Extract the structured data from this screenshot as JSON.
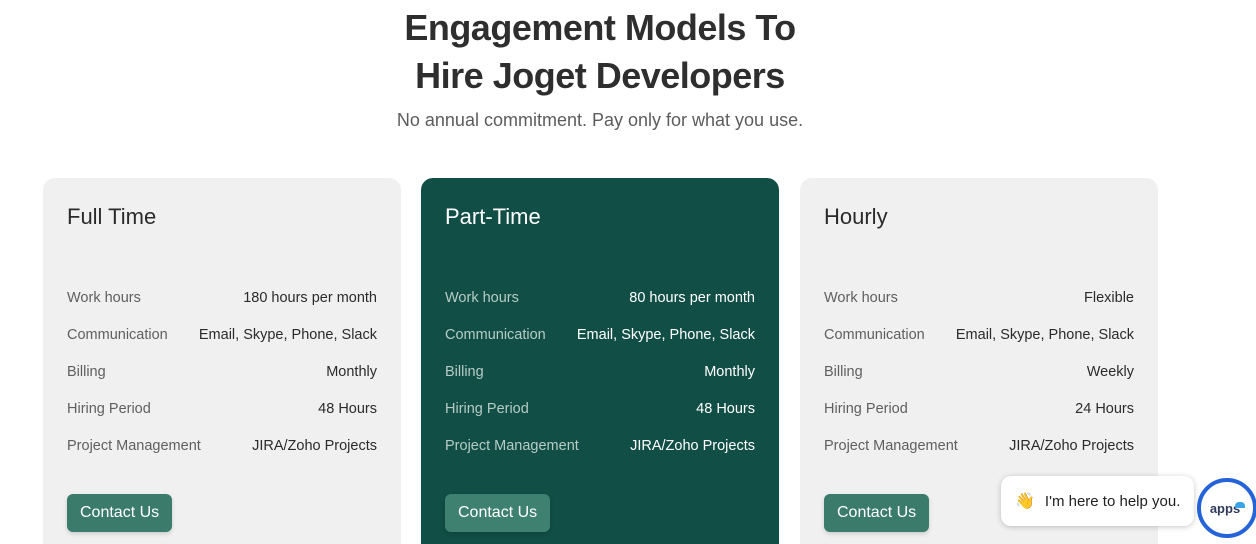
{
  "header": {
    "title_line1": "Engagement Models To",
    "title_line2": "Hire Joget Developers",
    "subtitle": "No annual commitment. Pay only for what you use."
  },
  "plans": [
    {
      "title": "Full Time",
      "rows": [
        {
          "label": "Work hours",
          "value": "180 hours per month"
        },
        {
          "label": "Communication",
          "value": "Email, Skype, Phone, Slack"
        },
        {
          "label": "Billing",
          "value": "Monthly"
        },
        {
          "label": "Hiring Period",
          "value": "48 Hours"
        },
        {
          "label": "Project Management",
          "value": "JIRA/Zoho Projects"
        }
      ],
      "button": "Contact Us"
    },
    {
      "title": "Part-Time",
      "rows": [
        {
          "label": "Work hours",
          "value": "80 hours per month"
        },
        {
          "label": "Communication",
          "value": "Email, Skype, Phone, Slack"
        },
        {
          "label": "Billing",
          "value": "Monthly"
        },
        {
          "label": "Hiring Period",
          "value": "48 Hours"
        },
        {
          "label": "Project Management",
          "value": "JIRA/Zoho Projects"
        }
      ],
      "button": "Contact Us"
    },
    {
      "title": "Hourly",
      "rows": [
        {
          "label": "Work hours",
          "value": "Flexible"
        },
        {
          "label": "Communication",
          "value": "Email, Skype, Phone, Slack"
        },
        {
          "label": "Billing",
          "value": "Weekly"
        },
        {
          "label": "Hiring Period",
          "value": "24 Hours"
        },
        {
          "label": "Project Management",
          "value": "JIRA/Zoho Projects"
        }
      ],
      "button": "Contact Us"
    }
  ],
  "chat": {
    "icon": "waving-hand-icon",
    "message": "I'm here to help you.",
    "badge_text": "apps"
  },
  "colors": {
    "featured_card": "#114e45",
    "button": "#3b7b6c",
    "card": "#eff0ef",
    "badge_ring": "#2563d8"
  }
}
